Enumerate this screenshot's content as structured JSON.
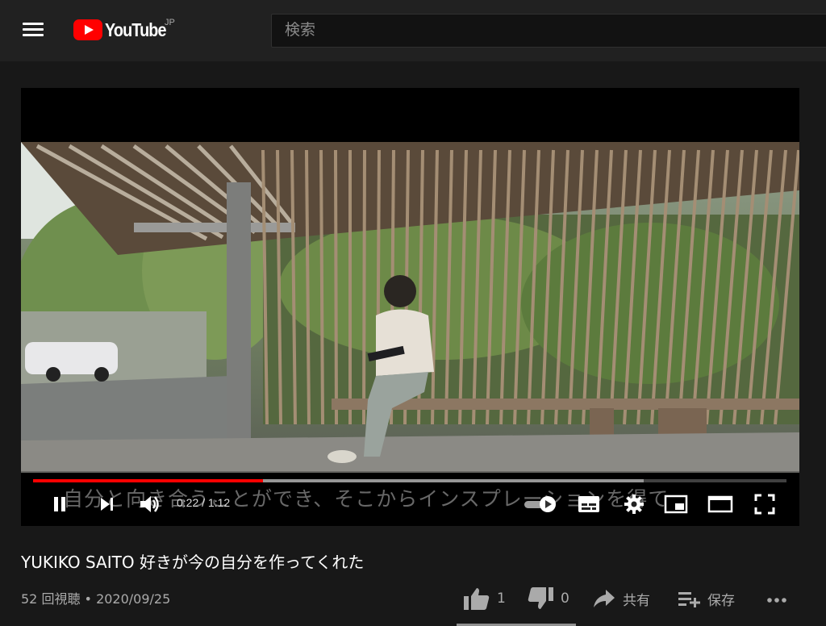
{
  "header": {
    "logo_text": "YouTube",
    "region": "JP",
    "search_placeholder": "検索"
  },
  "player": {
    "current_time": "0:22",
    "duration": "1:12",
    "time_separator": " / ",
    "played_fraction": 0.305,
    "loaded_fraction": 0.81,
    "subtitle": "自分と向き合うことができ、そこからインスプレーションを得て"
  },
  "video": {
    "title": "YUKIKO SAITO 好きが今の自分を作ってくれた",
    "views": "52 回視聴",
    "separator": " • ",
    "date": "2020/09/25"
  },
  "actions": {
    "like_count": "1",
    "dislike_count": "0",
    "share_label": "共有",
    "save_label": "保存"
  }
}
